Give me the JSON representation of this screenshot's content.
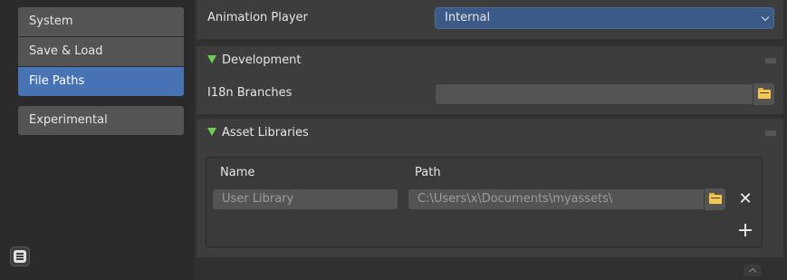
{
  "sidebar": {
    "items": [
      {
        "label": "System"
      },
      {
        "label": "Save & Load"
      },
      {
        "label": "File Paths"
      },
      {
        "label": "Experimental"
      }
    ],
    "active_index": 2
  },
  "animation_player": {
    "label": "Animation Player",
    "value": "Internal"
  },
  "development": {
    "title": "Development",
    "i18n_label": "I18n Branches",
    "i18n_value": ""
  },
  "asset_libraries": {
    "title": "Asset Libraries",
    "col_name": "Name",
    "col_path": "Path",
    "rows": [
      {
        "name": "User Library",
        "path": "C:\\Users\\x\\Documents\\myassets\\"
      }
    ]
  },
  "colors": {
    "accent": "#4772b3",
    "expand_triangle": "#6ccf4d",
    "folder": "#f5c84b"
  }
}
